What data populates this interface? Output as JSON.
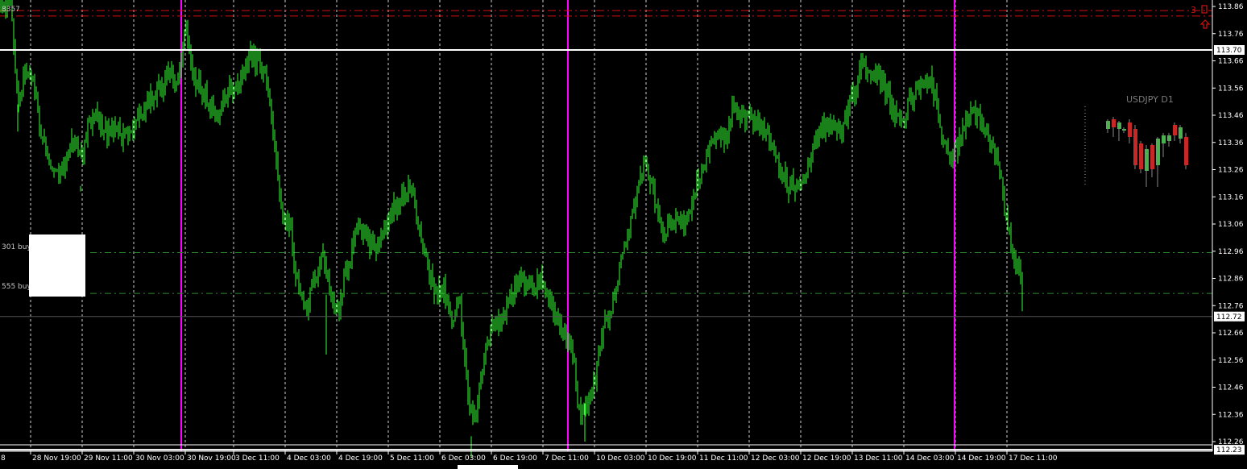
{
  "chart_data": {
    "type": "candlestick",
    "symbol": "USDJPY",
    "timeframe": "H1",
    "inset_label": "USDJPY D1",
    "ylim": [
      112.18,
      113.92
    ],
    "y_ticks": [
      "113.86",
      "113.76",
      "113.66",
      "113.56",
      "113.46",
      "113.36",
      "113.26",
      "113.16",
      "113.06",
      "112.96",
      "112.86",
      "112.76",
      "112.66",
      "112.56",
      "112.46",
      "112.36",
      "112.26"
    ],
    "price_markers": [
      {
        "label": "113.70",
        "value": 113.7,
        "color": "#ffffff",
        "style": "solid"
      },
      {
        "label": "112.72",
        "value": 112.72,
        "color": "#555555",
        "style": "solid"
      },
      {
        "label": "112.23",
        "value": 112.23,
        "color": "#ffffff",
        "style": "solid"
      }
    ],
    "levels": [
      {
        "value": 113.845,
        "color": "#d01010",
        "style": "dashdot"
      },
      {
        "value": 113.825,
        "color": "#d01010",
        "style": "dashdot"
      },
      {
        "value": 112.955,
        "color": "#2f8a2f",
        "style": "dashdot",
        "label": "301 buy"
      },
      {
        "value": 112.805,
        "color": "#2f8a2f",
        "style": "dashdot",
        "label": "555 buy"
      }
    ],
    "x_labels": [
      "8",
      "28 Nov 19:00",
      "29 Nov 11:00",
      "30 Nov 03:00",
      "30 Nov 19:00",
      "3 Dec 11:00",
      "4 Dec 03:00",
      "4 Dec 19:00",
      "5 Dec 11:00",
      "6 Dec 03:00",
      "6 Dec 19:00",
      "7 Dec 11:00",
      "10 Dec 03:00",
      "10 Dec 19:00",
      "11 Dec 11:00",
      "12 Dec 03:00",
      "12 Dec 19:00",
      "13 Dec 11:00",
      "14 Dec 03:00",
      "14 Dec 19:00",
      "17 Dec 11:00"
    ],
    "close_path": [
      [
        0,
        113.87
      ],
      [
        14,
        113.86
      ],
      [
        22,
        113.5
      ],
      [
        30,
        113.62
      ],
      [
        42,
        113.57
      ],
      [
        52,
        113.38
      ],
      [
        62,
        113.3
      ],
      [
        72,
        113.25
      ],
      [
        82,
        113.3
      ],
      [
        92,
        113.37
      ],
      [
        102,
        113.3
      ],
      [
        112,
        113.45
      ],
      [
        122,
        113.44
      ],
      [
        132,
        113.4
      ],
      [
        142,
        113.4
      ],
      [
        152,
        113.38
      ],
      [
        162,
        113.4
      ],
      [
        172,
        113.44
      ],
      [
        182,
        113.5
      ],
      [
        192,
        113.55
      ],
      [
        202,
        113.57
      ],
      [
        212,
        113.62
      ],
      [
        222,
        113.58
      ],
      [
        230,
        113.8
      ],
      [
        240,
        113.6
      ],
      [
        250,
        113.55
      ],
      [
        260,
        113.5
      ],
      [
        270,
        113.45
      ],
      [
        280,
        113.55
      ],
      [
        290,
        113.55
      ],
      [
        300,
        113.6
      ],
      [
        310,
        113.68
      ],
      [
        320,
        113.65
      ],
      [
        330,
        113.6
      ],
      [
        340,
        113.35
      ],
      [
        350,
        113.1
      ],
      [
        360,
        113.05
      ],
      [
        370,
        112.82
      ],
      [
        380,
        112.75
      ],
      [
        390,
        112.85
      ],
      [
        400,
        112.95
      ],
      [
        410,
        112.8
      ],
      [
        420,
        112.72
      ],
      [
        430,
        112.9
      ],
      [
        440,
        113.0
      ],
      [
        450,
        113.05
      ],
      [
        460,
        112.98
      ],
      [
        470,
        112.98
      ],
      [
        480,
        113.05
      ],
      [
        490,
        113.12
      ],
      [
        500,
        113.15
      ],
      [
        510,
        113.2
      ],
      [
        520,
        113.05
      ],
      [
        530,
        112.9
      ],
      [
        540,
        112.82
      ],
      [
        550,
        112.82
      ],
      [
        560,
        112.7
      ],
      [
        570,
        112.8
      ],
      [
        580,
        112.45
      ],
      [
        590,
        112.32
      ],
      [
        600,
        112.55
      ],
      [
        610,
        112.68
      ],
      [
        620,
        112.72
      ],
      [
        630,
        112.75
      ],
      [
        640,
        112.85
      ],
      [
        650,
        112.85
      ],
      [
        660,
        112.82
      ],
      [
        670,
        112.85
      ],
      [
        680,
        112.8
      ],
      [
        690,
        112.72
      ],
      [
        700,
        112.65
      ],
      [
        710,
        112.6
      ],
      [
        720,
        112.35
      ],
      [
        730,
        112.4
      ],
      [
        740,
        112.52
      ],
      [
        750,
        112.7
      ],
      [
        760,
        112.75
      ],
      [
        770,
        112.9
      ],
      [
        780,
        113.05
      ],
      [
        790,
        113.15
      ],
      [
        800,
        113.3
      ],
      [
        810,
        113.18
      ],
      [
        820,
        113.05
      ],
      [
        830,
        113.05
      ],
      [
        840,
        113.1
      ],
      [
        850,
        113.05
      ],
      [
        860,
        113.15
      ],
      [
        870,
        113.25
      ],
      [
        880,
        113.35
      ],
      [
        890,
        113.4
      ],
      [
        900,
        113.38
      ],
      [
        910,
        113.48
      ],
      [
        920,
        113.45
      ],
      [
        930,
        113.45
      ],
      [
        940,
        113.42
      ],
      [
        950,
        113.4
      ],
      [
        960,
        113.35
      ],
      [
        970,
        113.25
      ],
      [
        980,
        113.2
      ],
      [
        990,
        113.2
      ],
      [
        1000,
        113.25
      ],
      [
        1010,
        113.35
      ],
      [
        1020,
        113.42
      ],
      [
        1030,
        113.43
      ],
      [
        1040,
        113.4
      ],
      [
        1050,
        113.45
      ],
      [
        1060,
        113.55
      ],
      [
        1070,
        113.65
      ],
      [
        1080,
        113.6
      ],
      [
        1090,
        113.6
      ],
      [
        1100,
        113.55
      ],
      [
        1110,
        113.45
      ],
      [
        1120,
        113.45
      ],
      [
        1130,
        113.52
      ],
      [
        1140,
        113.55
      ],
      [
        1150,
        113.6
      ],
      [
        1160,
        113.55
      ],
      [
        1170,
        113.35
      ],
      [
        1180,
        113.3
      ],
      [
        1190,
        113.35
      ],
      [
        1200,
        113.45
      ],
      [
        1210,
        113.48
      ],
      [
        1220,
        113.42
      ],
      [
        1230,
        113.35
      ],
      [
        1240,
        113.28
      ],
      [
        1250,
        113.05
      ],
      [
        1258,
        112.95
      ],
      [
        1266,
        112.9
      ],
      [
        1270,
        112.73
      ]
    ],
    "session_markers": [
      225,
      705,
      1185
    ],
    "grid": true
  },
  "annotations": {
    "level_labels": [
      "301 buy",
      "555 buy"
    ],
    "top_left_text": "8357",
    "alert_number": "3"
  }
}
